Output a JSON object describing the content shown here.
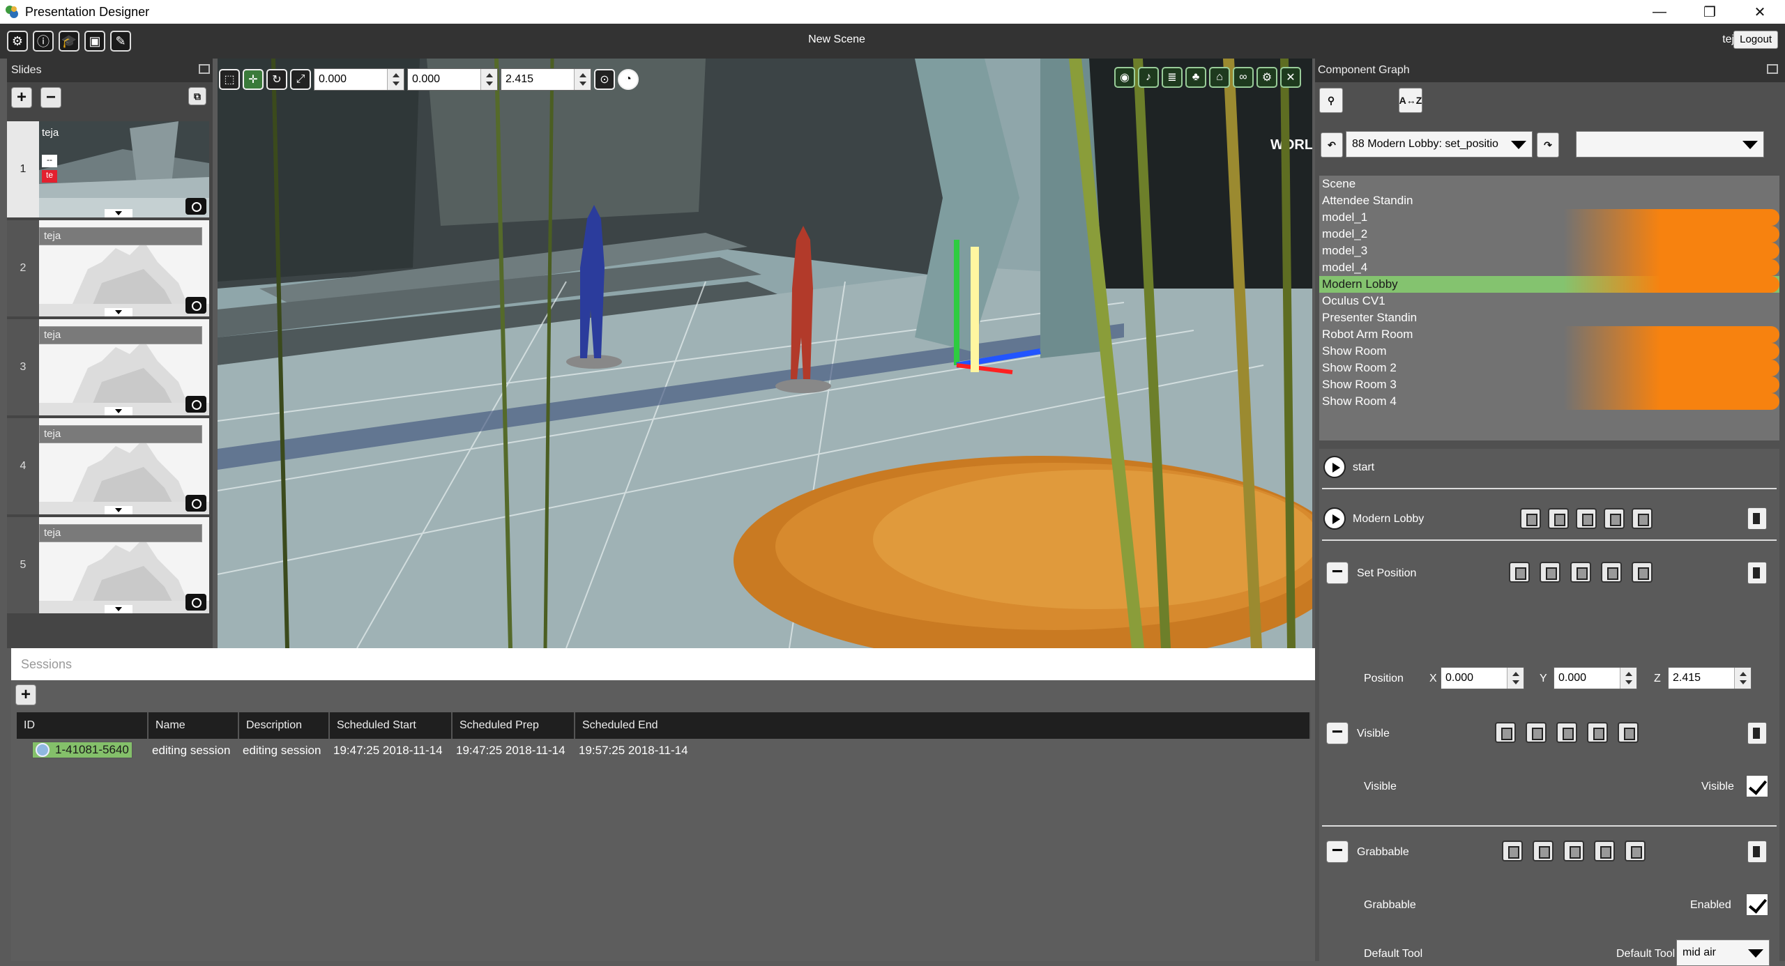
{
  "window": {
    "title": "Presentation Designer",
    "minimize": "—",
    "restore": "❐",
    "close": "✕"
  },
  "toolbar": {
    "scene_title": "New Scene",
    "user": "teja",
    "logout": "Logout"
  },
  "slides": {
    "header": "Slides",
    "add": "+",
    "remove": "−",
    "items": [
      {
        "number": "1",
        "name": "teja"
      },
      {
        "number": "2",
        "name": "teja"
      },
      {
        "number": "3",
        "name": "teja"
      },
      {
        "number": "4",
        "name": "teja"
      },
      {
        "number": "5",
        "name": "teja"
      }
    ],
    "first_slide_tags": [
      "--",
      "te"
    ]
  },
  "viewport": {
    "x": "0.000",
    "y": "0.000",
    "z": "2.415",
    "scene_text": "WORL",
    "colors": {
      "floor": "#8fa6aa",
      "wall": "#3c4446",
      "wood": "#d78a2e",
      "sky": "#a9b9ba"
    }
  },
  "sessions": {
    "search_placeholder": "Sessions",
    "add": "+",
    "columns": [
      "ID",
      "Name",
      "Description",
      "Scheduled Start",
      "Scheduled Prep",
      "Scheduled End"
    ],
    "rows": [
      {
        "id": "1-41081-5640",
        "name": "editing session",
        "description": "editing session",
        "start": "19:47:25 2018-11-14",
        "prep": "19:47:25 2018-11-14",
        "end": "19:57:25 2018-11-14"
      }
    ]
  },
  "component_graph": {
    "header": "Component Graph",
    "sort_label": "A↔Z",
    "history_value": "88 Modern Lobby: set_positio",
    "second_combo": "",
    "tree": [
      {
        "label": "Scene",
        "style": "plain"
      },
      {
        "label": "Attendee Standin",
        "style": "plain"
      },
      {
        "label": "model_1",
        "style": "orange"
      },
      {
        "label": "model_2",
        "style": "orange"
      },
      {
        "label": "model_3",
        "style": "orange"
      },
      {
        "label": "model_4",
        "style": "orange"
      },
      {
        "label": "Modern Lobby",
        "style": "selected"
      },
      {
        "label": "Oculus CV1",
        "style": "plain"
      },
      {
        "label": "Presenter Standin",
        "style": "plain"
      },
      {
        "label": "Robot Arm Room",
        "style": "orange"
      },
      {
        "label": "Show Room",
        "style": "orange"
      },
      {
        "label": "Show Room 2",
        "style": "orange"
      },
      {
        "label": "Show Room 3",
        "style": "orange"
      },
      {
        "label": "Show Room 4",
        "style": "orange"
      }
    ],
    "props": {
      "start": "start",
      "object": "Modern Lobby",
      "set_position": "Set Position",
      "position_label": "Position",
      "x_label": "X",
      "y_label": "Y",
      "z_label": "Z",
      "x": "0.000",
      "y": "0.000",
      "z": "2.415",
      "visible_section": "Visible",
      "visible_row": "Visible",
      "visible_check_label": "Visible",
      "grabbable_section": "Grabbable",
      "grabbable_row": "Grabbable",
      "enabled_label": "Enabled",
      "default_tool_row": "Default Tool",
      "default_tool_label": "Default Tool",
      "default_tool_value": "mid air"
    }
  }
}
